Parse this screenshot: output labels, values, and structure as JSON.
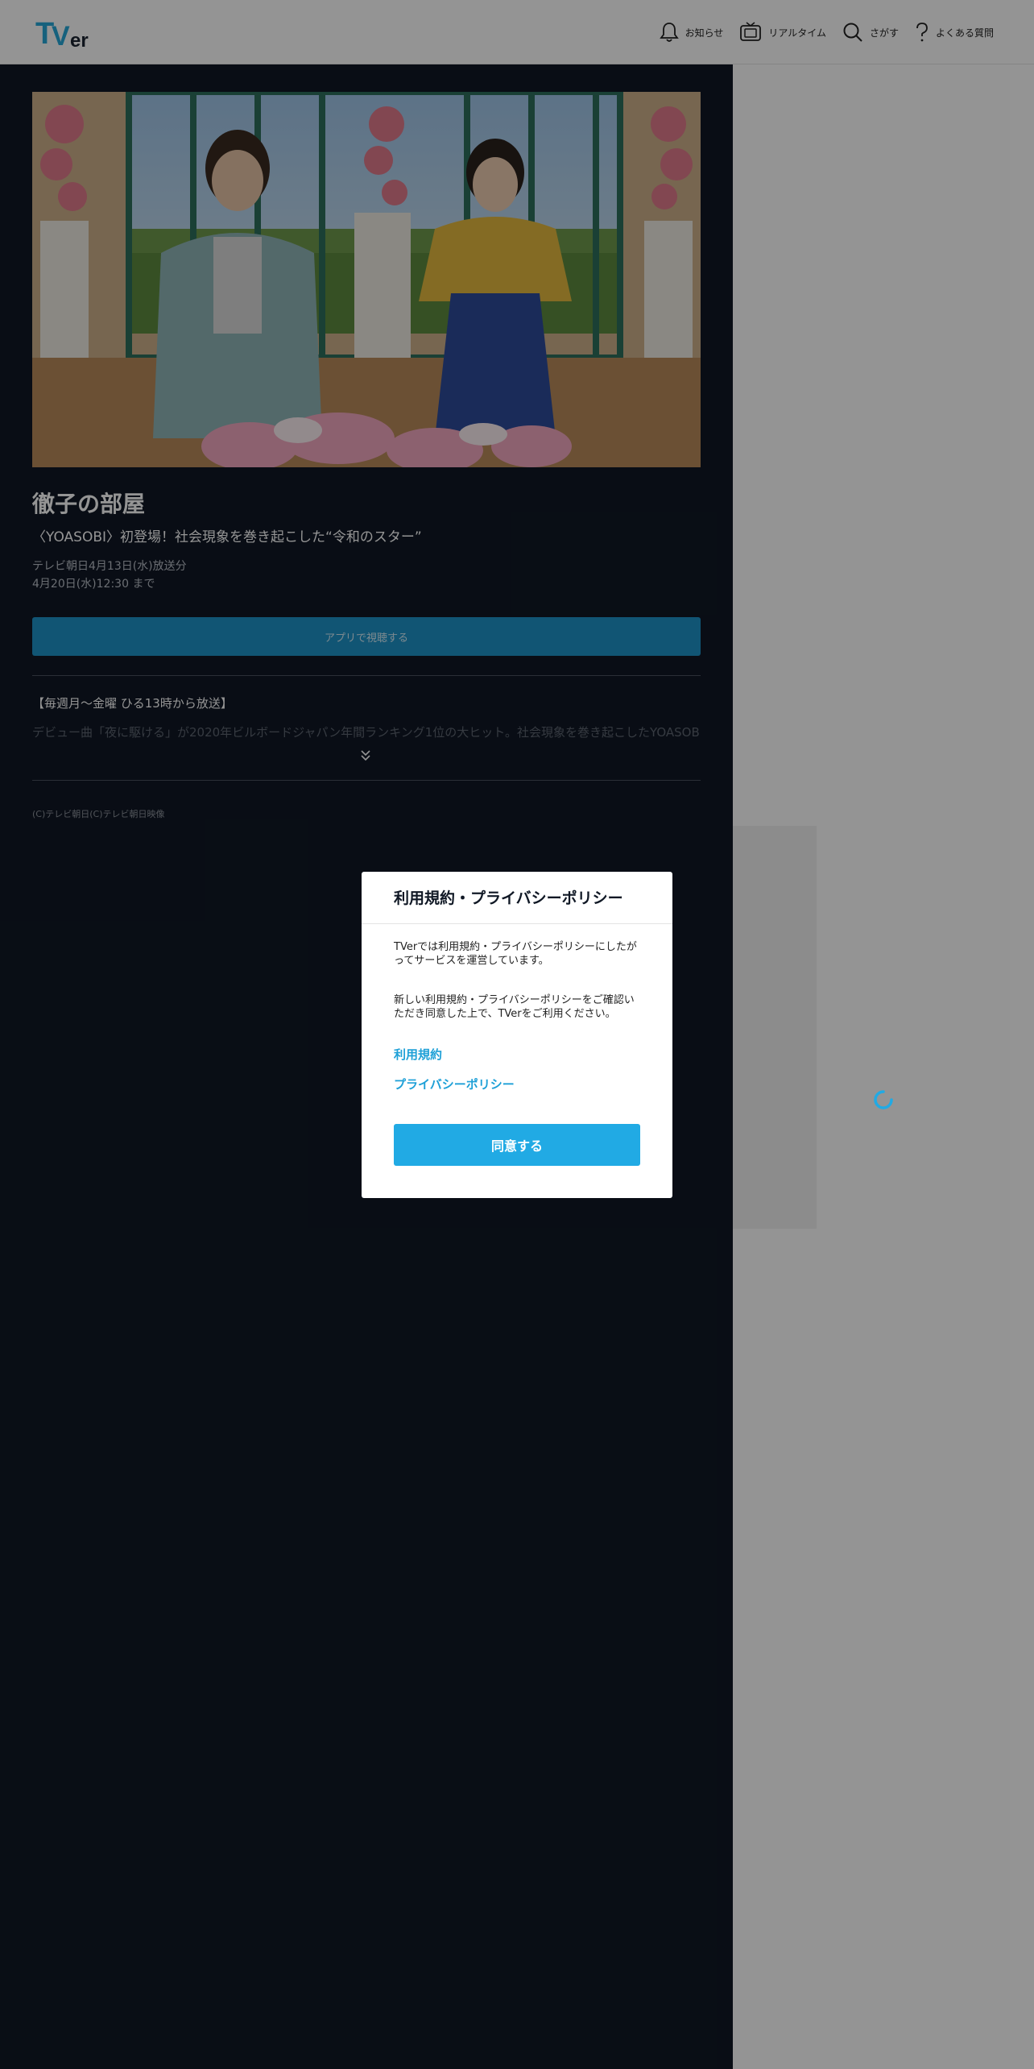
{
  "header": {
    "logo_text": "TVer",
    "nav": [
      {
        "label": "お知らせ",
        "icon": "bell-icon"
      },
      {
        "label": "リアルタイム",
        "icon": "tv-icon"
      },
      {
        "label": "さがす",
        "icon": "search-icon"
      },
      {
        "label": "よくある質問",
        "icon": "question-icon"
      }
    ]
  },
  "episode": {
    "title": "徹子の部屋",
    "subtitle": "〈YOASOBI〉初登場！社会現象を巻き起こした“令和のスター”",
    "broadcast": "テレビ朝日4月13日(水)放送分",
    "deadline": "4月20日(水)12:30 まで",
    "app_button": "アプリで視聴する",
    "description_line1": "【毎週月～金曜 ひる13時から放送】",
    "description_line2": "デビュー曲「夜に駆ける」が2020年ビルボードジャパン年間ランキング1位の大ヒット。社会現象を巻き起こしたYOASOBI",
    "copyright": "(C)テレビ朝日(C)テレビ朝日映像"
  },
  "modal": {
    "title": "利用規約・プライバシーポリシー",
    "paragraph1": "TVerでは利用規約・プライバシーポリシーにしたがってサービスを運営しています。",
    "paragraph2": "新しい利用規約・プライバシーポリシーをご確認いただき同意した上で、TVerをご利用ください。",
    "link_terms": "利用規約",
    "link_privacy": "プライバシーポリシー",
    "agree_button": "同意する"
  },
  "colors": {
    "brand_blue": "#21aae4",
    "dark_bg": "#101825",
    "app_button": "#1e93c8"
  }
}
